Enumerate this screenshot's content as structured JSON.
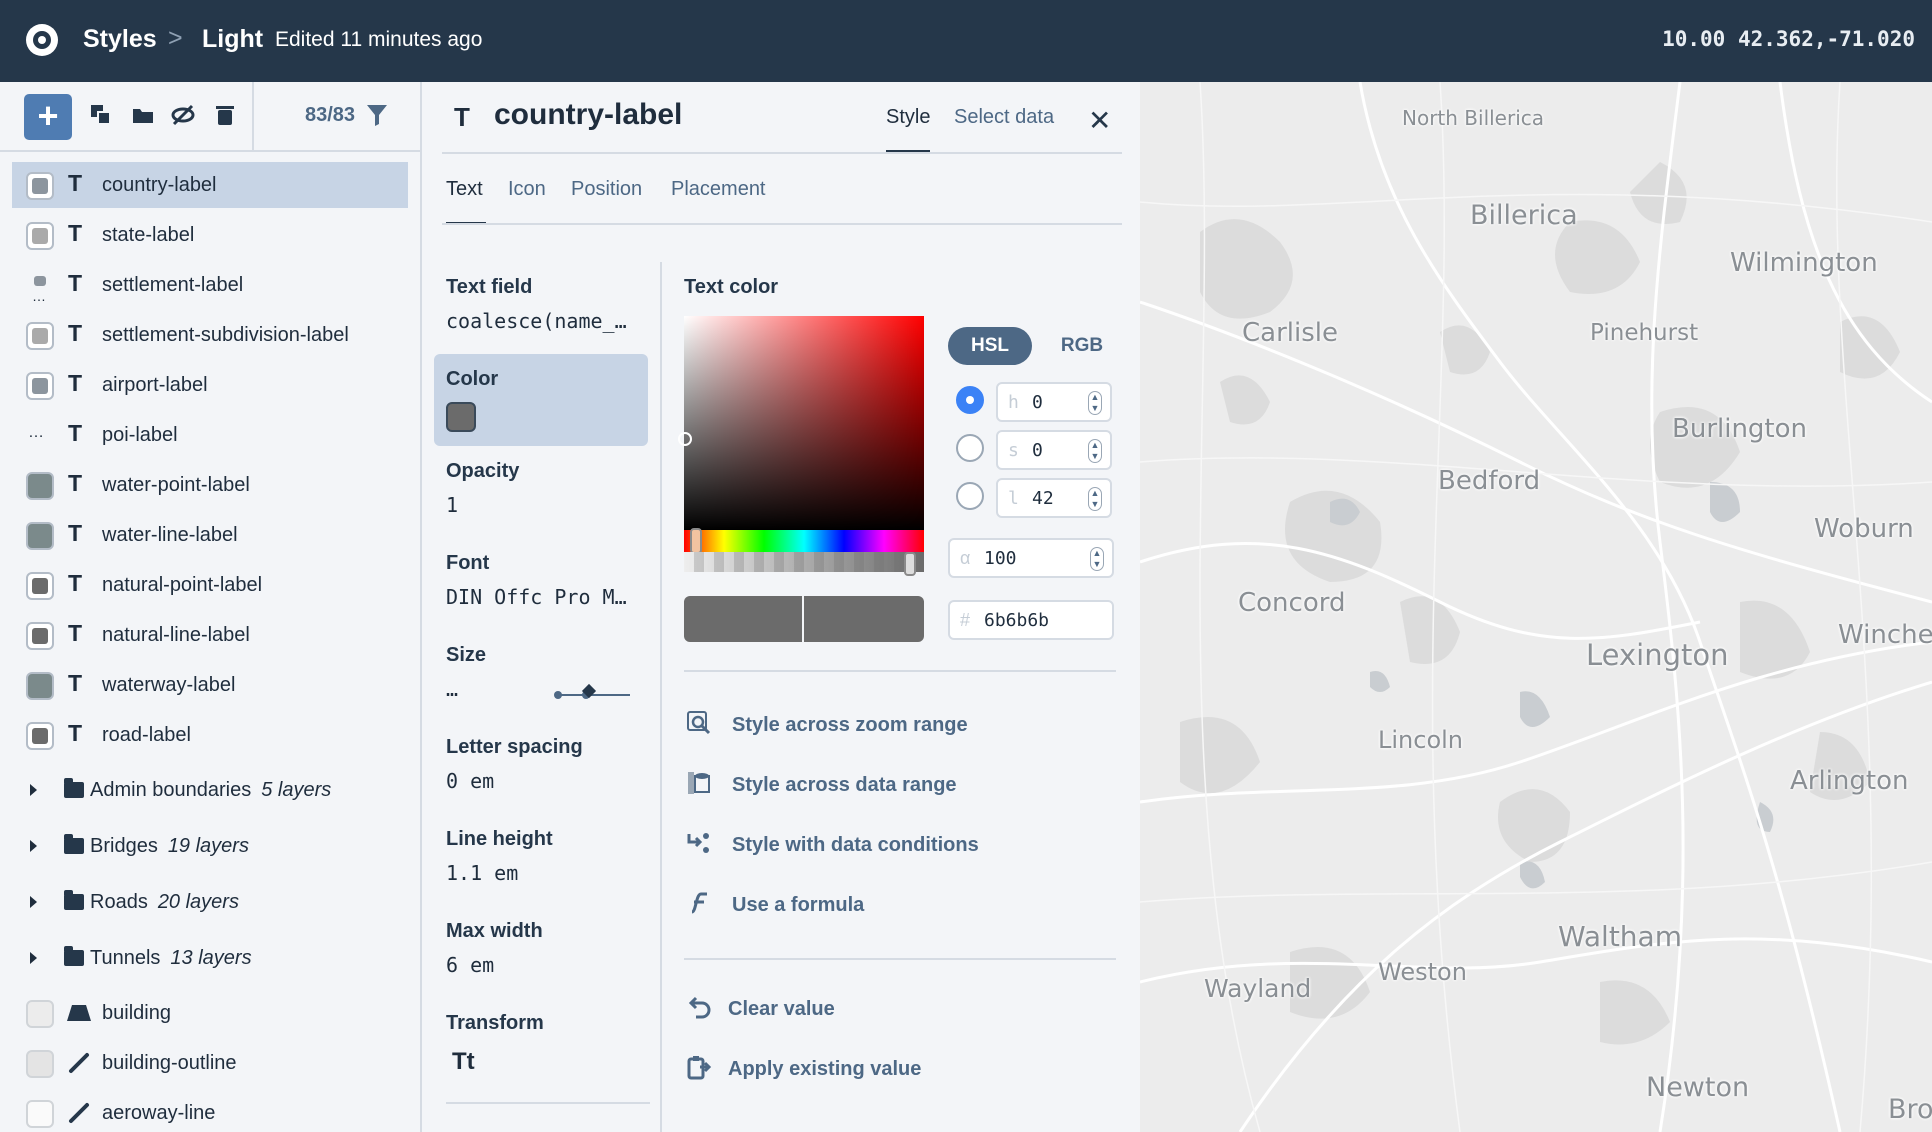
{
  "topbar": {
    "styles_label": "Styles",
    "separator": ">",
    "style_name": "Light",
    "edited": "Edited 11 minutes ago",
    "zoom": "10.00",
    "coords": "42.362,-71.020"
  },
  "layers_panel": {
    "add_label": "+",
    "count": "83/83",
    "layers": [
      {
        "name": "country-label",
        "swatch": "icon",
        "active": true
      },
      {
        "name": "state-label",
        "swatch": "#aaaaaa"
      },
      {
        "name": "settlement-label",
        "swatch": "icon-dots"
      },
      {
        "name": "settlement-subdivision-label",
        "swatch": "#aaaaaa"
      },
      {
        "name": "airport-label",
        "swatch": "icon"
      },
      {
        "name": "poi-label",
        "swatch": "dots"
      },
      {
        "name": "water-point-label",
        "swatch": "#7b8a8b"
      },
      {
        "name": "water-line-label",
        "swatch": "#7b8a8b"
      },
      {
        "name": "natural-point-label",
        "swatch": "#6b6b6b"
      },
      {
        "name": "natural-line-label",
        "swatch": "#6b6b6b"
      },
      {
        "name": "waterway-label",
        "swatch": "#7b8a8b"
      },
      {
        "name": "road-label",
        "swatch": "#6b6b6b"
      }
    ],
    "groups": [
      {
        "name": "Admin boundaries",
        "count": "5 layers"
      },
      {
        "name": "Bridges",
        "count": "19 layers"
      },
      {
        "name": "Roads",
        "count": "20 layers"
      },
      {
        "name": "Tunnels",
        "count": "13 layers"
      }
    ],
    "bottom_layers": [
      {
        "name": "building",
        "icon": "fill-icon"
      },
      {
        "name": "building-outline",
        "icon": "line-icon"
      },
      {
        "name": "aeroway-line",
        "icon": "line-icon"
      }
    ]
  },
  "editor": {
    "type_glyph": "T",
    "layer_name": "country-label",
    "tab_style": "Style",
    "tab_select_data": "Select data",
    "close": "✕",
    "subtabs": [
      "Text",
      "Icon",
      "Position",
      "Placement"
    ],
    "props": {
      "text_field_label": "Text field",
      "text_field_value": "coalesce(name_…",
      "color_label": "Color",
      "opacity_label": "Opacity",
      "opacity_value": "1",
      "font_label": "Font",
      "font_value": "DIN Offc Pro M…",
      "size_label": "Size",
      "size_value": "…",
      "letter_spacing_label": "Letter spacing",
      "letter_spacing_value": "0 em",
      "line_height_label": "Line height",
      "line_height_value": "1.1 em",
      "max_width_label": "Max width",
      "max_width_value": "6 em",
      "transform_label": "Transform",
      "transform_glyph": "Tt"
    },
    "text_color": {
      "label": "Text color",
      "mode_hsl": "HSL",
      "mode_rgb": "RGB",
      "h_prefix": "h",
      "h_value": "0",
      "s_prefix": "s",
      "s_value": "0",
      "l_prefix": "l",
      "l_value": "42",
      "a_prefix": "α",
      "a_value": "100",
      "hex_prefix": "#",
      "hex_value": "6b6b6b",
      "color": "#6b6b6b"
    },
    "actions": [
      {
        "label": "Style across zoom range",
        "icon": "zoom-range-icon"
      },
      {
        "label": "Style across data range",
        "icon": "data-range-icon"
      },
      {
        "label": "Style with data conditions",
        "icon": "data-conditions-icon"
      },
      {
        "label": "Use a formula",
        "icon": "formula-icon"
      }
    ],
    "value_actions": [
      {
        "label": "Clear value",
        "icon": "undo-icon"
      },
      {
        "label": "Apply existing value",
        "icon": "clipboard-icon"
      }
    ]
  },
  "map": {
    "places": [
      {
        "name": "North Billerica"
      },
      {
        "name": "Billerica"
      },
      {
        "name": "Wilmington"
      },
      {
        "name": "Carlisle"
      },
      {
        "name": "Pinehurst"
      },
      {
        "name": "Burlington"
      },
      {
        "name": "Bedford"
      },
      {
        "name": "Woburn"
      },
      {
        "name": "Concord"
      },
      {
        "name": "Winche"
      },
      {
        "name": "Lexington"
      },
      {
        "name": "Lincoln"
      },
      {
        "name": "Arlington"
      },
      {
        "name": "Waltham"
      },
      {
        "name": "Weston"
      },
      {
        "name": "Wayland"
      },
      {
        "name": "Newton"
      },
      {
        "name": "Bro"
      }
    ]
  }
}
